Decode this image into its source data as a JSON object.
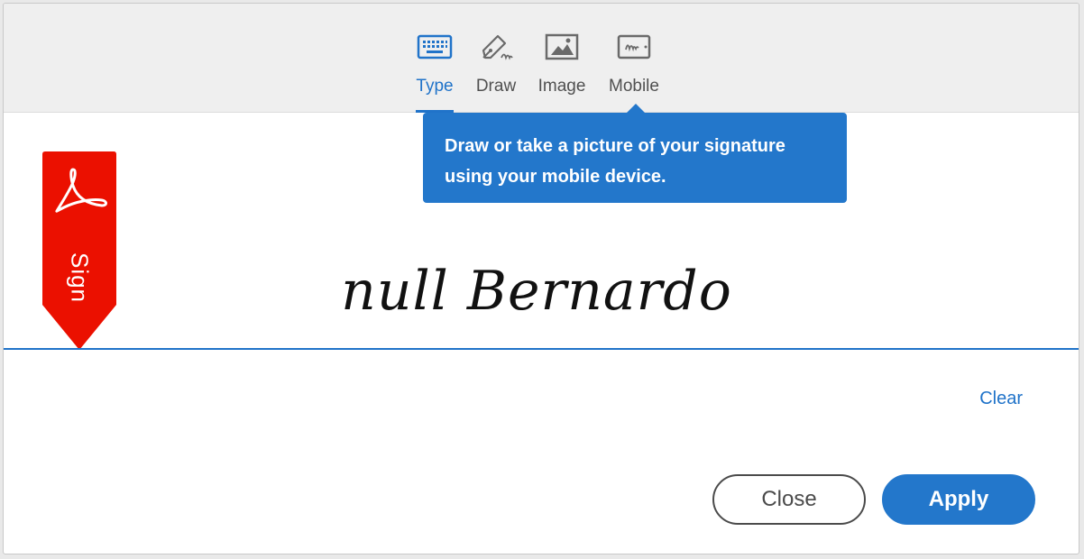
{
  "tabs": [
    {
      "label": "Type",
      "icon": "keyboard-icon",
      "active": true
    },
    {
      "label": "Draw",
      "icon": "pen-icon",
      "active": false
    },
    {
      "label": "Image",
      "icon": "image-icon",
      "active": false
    },
    {
      "label": "Mobile",
      "icon": "mobile-icon",
      "active": false
    }
  ],
  "tooltip": {
    "line1": "Draw or take a picture of your signature",
    "line2": "using your mobile device."
  },
  "sign_tag": {
    "label": "Sign",
    "icon": "acrobat-icon",
    "color": "#eb1000"
  },
  "signature": {
    "text": "null Bernardo"
  },
  "actions": {
    "clear_label": "Clear",
    "close_label": "Close",
    "apply_label": "Apply"
  },
  "colors": {
    "accent": "#2073c9",
    "tooltip_bg": "#2377cb"
  }
}
